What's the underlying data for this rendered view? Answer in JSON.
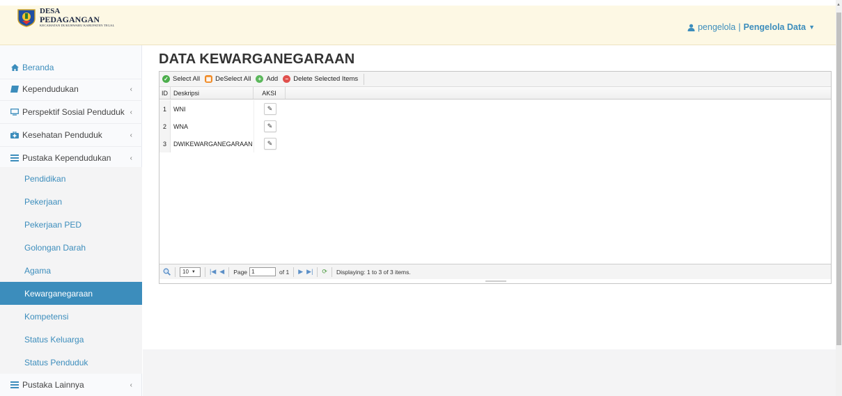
{
  "header": {
    "logo": {
      "line1": "DESA",
      "line2": "PEDAGANGAN",
      "line3": "KECAMATAN DUKUHWARU KABUPATEN TEGAL"
    },
    "user": {
      "name": "pengelola",
      "separator": "|",
      "role": "Pengelola Data",
      "icon": "user-icon"
    }
  },
  "sidebar": {
    "items": [
      {
        "label": "Beranda",
        "icon": "home-icon"
      },
      {
        "label": "Kependudukan",
        "icon": "book-icon"
      },
      {
        "label": "Perspektif Sosial Penduduk",
        "icon": "monitor-icon"
      },
      {
        "label": "Kesehatan Penduduk",
        "icon": "medkit-icon"
      },
      {
        "label": "Pustaka Kependudukan",
        "icon": "list-icon"
      }
    ],
    "subitems": [
      {
        "label": "Pendidikan"
      },
      {
        "label": "Pekerjaan"
      },
      {
        "label": "Pekerjaan PED"
      },
      {
        "label": "Golongan Darah"
      },
      {
        "label": "Agama"
      },
      {
        "label": "Kewarganegaraan",
        "active": true
      },
      {
        "label": "Kompetensi"
      },
      {
        "label": "Status Keluarga"
      },
      {
        "label": "Status Penduduk"
      }
    ],
    "last": {
      "label": "Pustaka Lainnya",
      "icon": "list-icon"
    }
  },
  "main": {
    "title": "DATA KEWARGANEGARAAN",
    "toolbar": {
      "select_all": "Select All",
      "deselect_all": "DeSelect All",
      "add": "Add",
      "delete_selected": "Delete Selected Items"
    },
    "table": {
      "columns": [
        "ID",
        "Deskripsi",
        "AKSI"
      ],
      "rows": [
        {
          "id": "1",
          "deskripsi": "WNI"
        },
        {
          "id": "2",
          "deskripsi": "WNA"
        },
        {
          "id": "3",
          "deskripsi": "DWIKEWARGANEGARAAN"
        }
      ]
    },
    "pager": {
      "page_size": "10",
      "page_label": "Page",
      "page_value": "1",
      "of_label": "of 1",
      "display_text": "Displaying: 1 to 3 of 3 items."
    }
  },
  "colors": {
    "accent": "#3c8dbc",
    "header_bg": "#fdf8e4",
    "sidebar_bg": "#f9fafc",
    "sub_bg": "#f4f4f5"
  }
}
